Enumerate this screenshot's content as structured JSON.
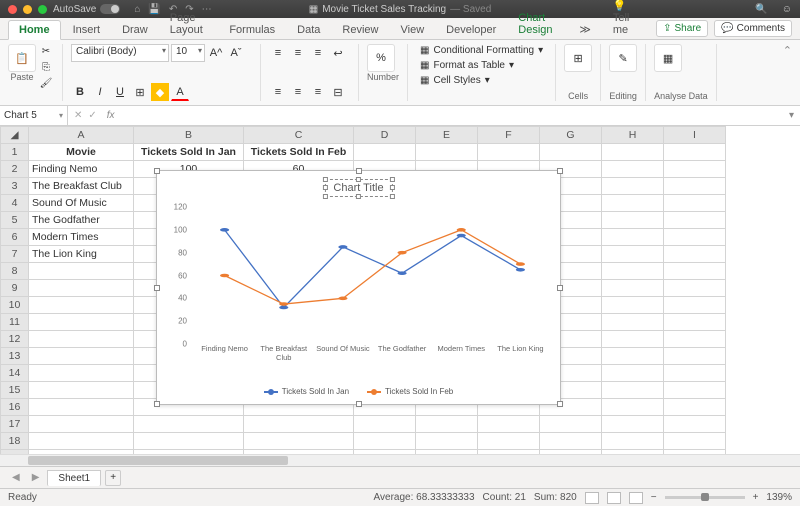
{
  "titlebar": {
    "autosave": "AutoSave",
    "doc": "Movie Ticket Sales Tracking",
    "status": "Saved"
  },
  "tabs": {
    "items": [
      "Home",
      "Insert",
      "Draw",
      "Page Layout",
      "Formulas",
      "Data",
      "Review",
      "View",
      "Developer",
      "Chart Design"
    ],
    "tell": "Tell me",
    "share": "Share",
    "comments": "Comments"
  },
  "ribbon": {
    "paste": "Paste",
    "font_name": "Calibri (Body)",
    "font_size": "10",
    "number": "Number",
    "cf": "Conditional Formatting",
    "fat": "Format as Table",
    "cs": "Cell Styles",
    "cells": "Cells",
    "editing": "Editing",
    "analyse": "Analyse Data"
  },
  "namebox": {
    "ref": "Chart 5"
  },
  "columns": [
    "A",
    "B",
    "C",
    "D",
    "E",
    "F",
    "G",
    "H",
    "I"
  ],
  "headers": {
    "movie": "Movie",
    "jan": "Tickets Sold In Jan",
    "feb": "Tickets Sold In Feb"
  },
  "rows": [
    {
      "m": "Finding Nemo",
      "j": "100",
      "f": "60"
    },
    {
      "m": "The Breakfast Club",
      "j": "30",
      "f": "35"
    },
    {
      "m": "Sound Of Music",
      "j": "",
      "f": ""
    },
    {
      "m": "The Godfather",
      "j": "",
      "f": ""
    },
    {
      "m": "Modern Times",
      "j": "",
      "f": ""
    },
    {
      "m": "The Lion King",
      "j": "",
      "f": ""
    }
  ],
  "chart_data": {
    "type": "line",
    "title": "Chart Title",
    "categories": [
      "Finding Nemo",
      "The Breakfast Club",
      "Sound Of Music",
      "The Godfather",
      "Modern Times",
      "The Lion King"
    ],
    "series": [
      {
        "name": "Tickets Sold In Jan",
        "color": "#4472c4",
        "values": [
          100,
          32,
          85,
          62,
          95,
          65
        ]
      },
      {
        "name": "Tickets Sold In Feb",
        "color": "#ed7d31",
        "values": [
          60,
          35,
          40,
          80,
          100,
          70
        ]
      }
    ],
    "ylim": [
      0,
      120
    ],
    "yticks": [
      0,
      20,
      40,
      60,
      80,
      100,
      120
    ]
  },
  "sheet": {
    "name": "Sheet1"
  },
  "status": {
    "ready": "Ready",
    "avg": "Average: 68.33333333",
    "count": "Count: 21",
    "sum": "Sum: 820",
    "zoom": "139%"
  }
}
